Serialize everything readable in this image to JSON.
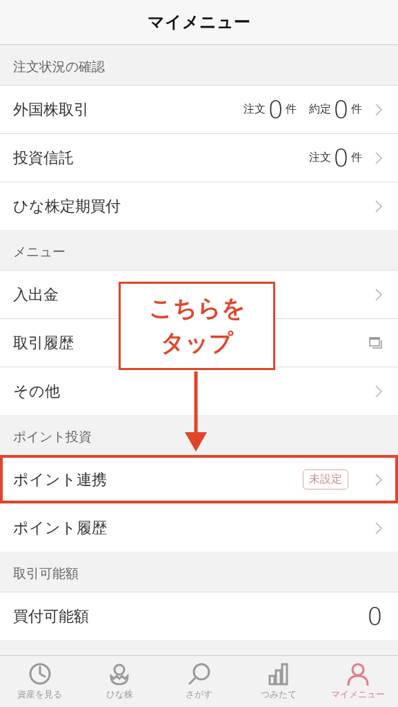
{
  "header": {
    "title": "マイメニュー"
  },
  "sections": [
    {
      "title": "注文状況の確認",
      "rows": [
        {
          "kind": "link",
          "label": "外国株取引",
          "counts": [
            {
              "label": "注文",
              "count": "0",
              "unit": "件"
            },
            {
              "label": "約定",
              "count": "0",
              "unit": "件"
            }
          ],
          "highlighted": false
        },
        {
          "kind": "link",
          "label": "投資信託",
          "counts": [
            {
              "label": "注文",
              "count": "0",
              "unit": "件"
            }
          ],
          "highlighted": false
        },
        {
          "kind": "link",
          "label": "ひな株定期買付",
          "highlighted": false
        }
      ]
    },
    {
      "title": "メニュー",
      "rows": [
        {
          "kind": "link",
          "label": "入出金",
          "highlighted": false
        },
        {
          "kind": "external",
          "label": "取引履歴",
          "highlighted": false
        },
        {
          "kind": "link",
          "label": "その他",
          "highlighted": false
        }
      ]
    },
    {
      "title": "ポイント投資",
      "rows": [
        {
          "kind": "link",
          "label": "ポイント連携",
          "badge": "未設定",
          "highlighted": true
        },
        {
          "kind": "link",
          "label": "ポイント履歴",
          "highlighted": false
        }
      ]
    },
    {
      "title": "取引可能額",
      "rows": [
        {
          "kind": "amount",
          "label": "買付可能額",
          "value": "0",
          "highlighted": false
        }
      ]
    }
  ],
  "callout": {
    "lines": [
      "こちらを",
      "タップ"
    ]
  },
  "tab_bar": [
    {
      "label": "資産を見る",
      "selected": false
    },
    {
      "label": "ひな株",
      "selected": false
    },
    {
      "label": "さがす",
      "selected": false
    },
    {
      "label": "つみたて",
      "selected": false
    },
    {
      "label": "マイメニュー",
      "selected": true
    }
  ]
}
